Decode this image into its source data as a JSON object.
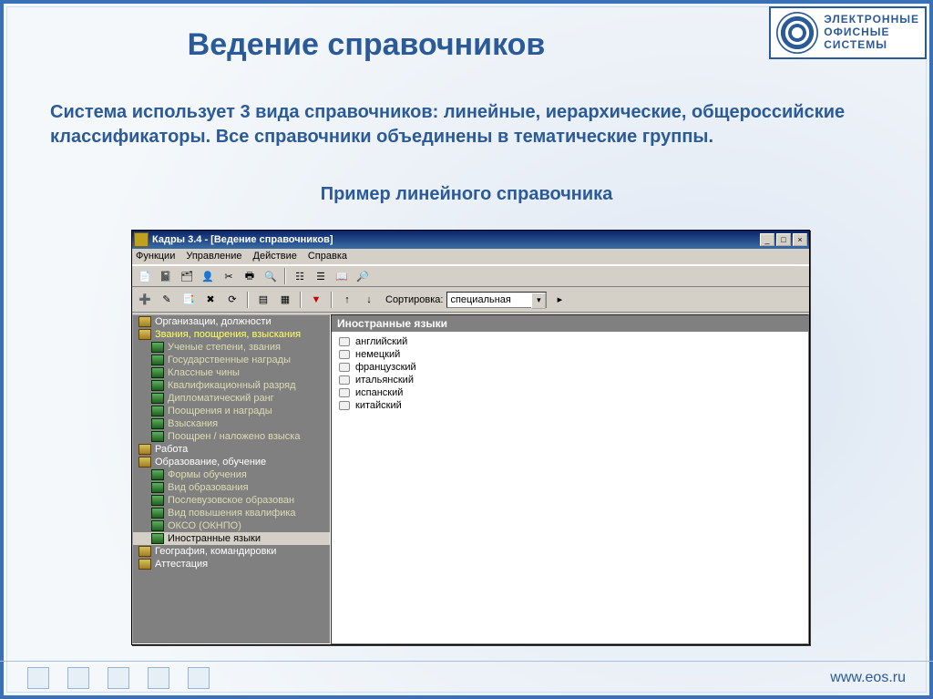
{
  "slide": {
    "title": "Ведение справочников",
    "description": "Система использует 3 вида справочников: линейные, иерархические, общероссийские классификаторы. Все справочники объединены в тематические группы.",
    "subtitle": "Пример линейного справочника"
  },
  "brand": {
    "line1": "ЭЛЕКТРОННЫЕ",
    "line2": "ОФИСНЫЕ",
    "line3": "СИСТЕМЫ",
    "url": "www.eos.ru"
  },
  "window": {
    "title": "Кадры 3.4 - [Ведение справочников]",
    "menu": [
      "Функции",
      "Управление",
      "Действие",
      "Справка"
    ],
    "sort_label": "Сортировка:",
    "sort_value": "специальная"
  },
  "tree": [
    {
      "label": "Организации, должности",
      "kind": "root"
    },
    {
      "label": "Звания, поощрения, взыскания",
      "kind": "root",
      "highlight": true
    },
    {
      "label": "Ученые степени, звания",
      "kind": "child"
    },
    {
      "label": "Государственные награды",
      "kind": "child"
    },
    {
      "label": "Классные чины",
      "kind": "child"
    },
    {
      "label": "Квалификационный разряд",
      "kind": "child"
    },
    {
      "label": "Дипломатический ранг",
      "kind": "child"
    },
    {
      "label": "Поощрения и награды",
      "kind": "child"
    },
    {
      "label": "Взыскания",
      "kind": "child"
    },
    {
      "label": "Поощрен / наложено взыска",
      "kind": "child"
    },
    {
      "label": "Работа",
      "kind": "root"
    },
    {
      "label": "Образование, обучение",
      "kind": "root"
    },
    {
      "label": "Формы обучения",
      "kind": "child"
    },
    {
      "label": "Вид образования",
      "kind": "child"
    },
    {
      "label": "Послевузовское образован",
      "kind": "child"
    },
    {
      "label": "Вид повышения квалифика",
      "kind": "child"
    },
    {
      "label": "ОКСО (ОКНПО)",
      "kind": "child"
    },
    {
      "label": "Иностранные языки",
      "kind": "child",
      "selected": true
    },
    {
      "label": "География, командировки",
      "kind": "root"
    },
    {
      "label": "Аттестация",
      "kind": "root-cut"
    }
  ],
  "list": {
    "header": "Иностранные языки",
    "items": [
      "английский",
      "немецкий",
      "французский",
      "итальянский",
      "испанский",
      "китайский"
    ]
  }
}
